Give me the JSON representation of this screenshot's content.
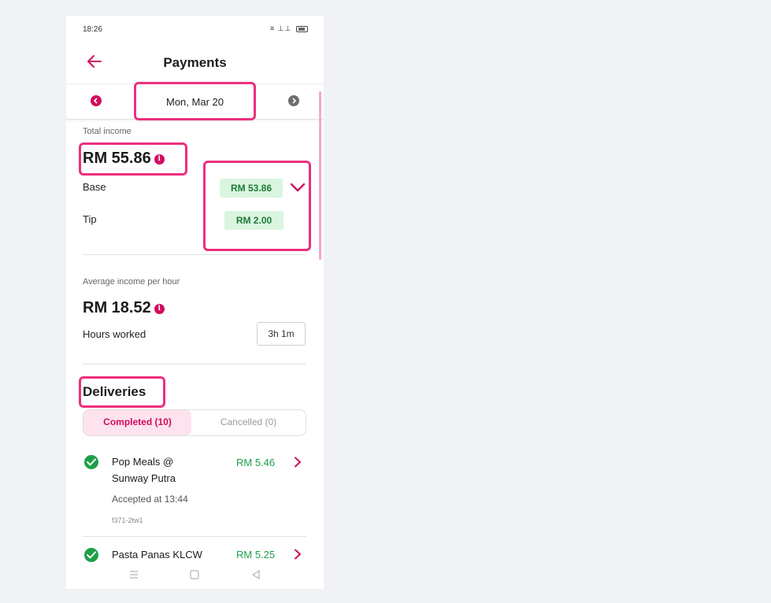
{
  "status_bar": {
    "time": "18:26",
    "icons": "▦ ᵗᵗᵗ ▗▖ ▂▄▆"
  },
  "header": {
    "title": "Payments"
  },
  "date_selector": {
    "date": "Mon, Mar 20"
  },
  "total_income": {
    "label": "Total income",
    "amount": "RM 55.86",
    "base_label": "Base",
    "base_value": "RM 53.86",
    "tip_label": "Tip",
    "tip_value": "RM 2.00"
  },
  "average_income": {
    "label": "Average income per hour",
    "amount": "RM 18.52",
    "hours_label": "Hours worked",
    "hours_value": "3h 1m"
  },
  "deliveries": {
    "title": "Deliveries",
    "tabs": [
      {
        "label": "Completed (10)",
        "active": true
      },
      {
        "label": "Cancelled (0)",
        "active": false
      }
    ],
    "items": [
      {
        "name_line1": "Pop Meals @",
        "name_line2": "Sunway Putra",
        "amount": "RM 5.46",
        "accepted": "Accepted at 13:44",
        "code": "f371-2tw1"
      },
      {
        "name_line1": "Pasta Panas KLCW",
        "amount": "RM 5.25"
      }
    ]
  },
  "colors": {
    "accent": "#d10b5f",
    "highlight": "#ec2f7f",
    "pill_bg": "#d9f5df",
    "pill_text": "#1e7a35",
    "success": "#1f9e48"
  }
}
